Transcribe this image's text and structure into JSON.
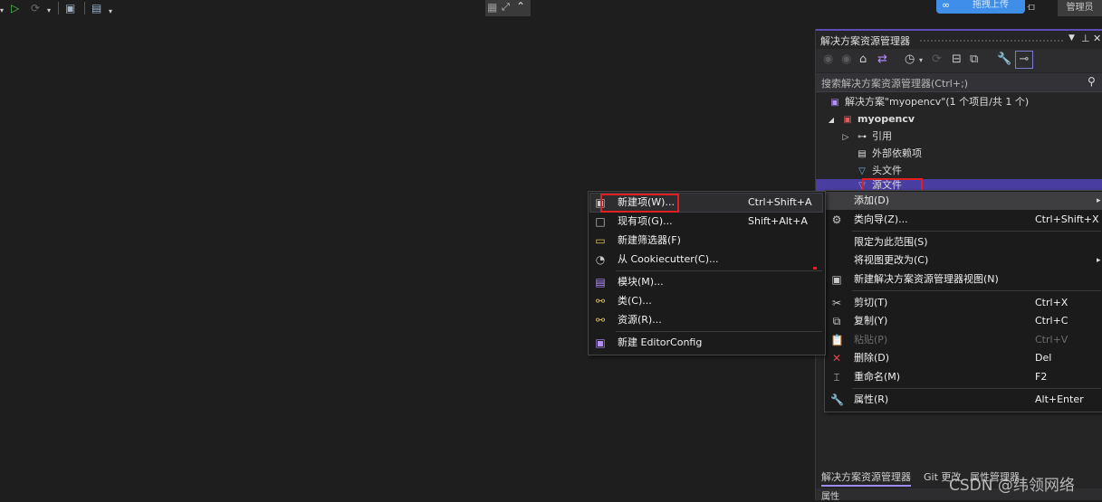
{
  "toolbar": {
    "icons": [
      "dropdown-arrow-icon",
      "run-icon",
      "debug-target-icon",
      "dropdown-arrow-icon",
      "folder-icon",
      "window-layout-icon",
      "dropdown-arrow-icon"
    ],
    "center_icons": [
      "grid-icon",
      "expand-icon",
      "chevron-up-icon"
    ],
    "upload_label": "拖拽上传",
    "admin_label": "管理员"
  },
  "solution_explorer": {
    "title": "解决方案资源管理器",
    "pin_glyphs": [
      "▾",
      "ⲡ",
      "✕"
    ],
    "search_placeholder": "搜索解决方案资源管理器(Ctrl+;)",
    "tree": [
      {
        "label": "解决方案\"myopencv\"(1 个项目/共 1 个)",
        "icon": "solution-icon"
      },
      {
        "label": "myopencv",
        "icon": "project-icon"
      },
      {
        "label": "引用",
        "icon": "references-icon"
      },
      {
        "label": "外部依赖项",
        "icon": "external-deps-icon"
      },
      {
        "label": "头文件",
        "icon": "filter-folder-icon"
      },
      {
        "label": "源文件",
        "icon": "filter-folder-icon"
      }
    ],
    "bottom_tabs": [
      "解决方案资源管理器",
      "Git 更改",
      "属性管理器"
    ],
    "properties_label": "属性"
  },
  "context_menu_main": {
    "items": [
      {
        "label": "添加(D)",
        "shortcut": "",
        "submenu": true,
        "icon": ""
      },
      {
        "label": "类向导(Z)...",
        "shortcut": "Ctrl+Shift+X",
        "icon": "class-wizard-icon"
      },
      {
        "label": "限定为此范围(S)",
        "shortcut": "",
        "icon": ""
      },
      {
        "label": "将视图更改为(C)",
        "shortcut": "",
        "submenu": true,
        "icon": ""
      },
      {
        "label": "新建解决方案资源管理器视图(N)",
        "shortcut": "",
        "icon": "new-view-icon"
      },
      {
        "label": "剪切(T)",
        "shortcut": "Ctrl+X",
        "icon": "cut-icon"
      },
      {
        "label": "复制(Y)",
        "shortcut": "Ctrl+C",
        "icon": "copy-icon"
      },
      {
        "label": "粘贴(P)",
        "shortcut": "Ctrl+V",
        "icon": "paste-icon",
        "disabled": true
      },
      {
        "label": "删除(D)",
        "shortcut": "Del",
        "icon": "delete-icon"
      },
      {
        "label": "重命名(M)",
        "shortcut": "F2",
        "icon": "rename-icon"
      },
      {
        "label": "属性(R)",
        "shortcut": "Alt+Enter",
        "icon": "properties-wrench-icon"
      }
    ]
  },
  "context_menu_add": {
    "items": [
      {
        "label": "新建项(W)...",
        "shortcut": "Ctrl+Shift+A",
        "icon": "new-item-icon"
      },
      {
        "label": "现有项(G)...",
        "shortcut": "Shift+Alt+A",
        "icon": "existing-item-icon"
      },
      {
        "label": "新建筛选器(F)",
        "shortcut": "",
        "icon": "new-filter-icon"
      },
      {
        "label": "从 Cookiecutter(C)...",
        "shortcut": "",
        "icon": "cookiecutter-icon"
      },
      {
        "label": "模块(M)...",
        "shortcut": "",
        "icon": "module-icon"
      },
      {
        "label": "类(C)...",
        "shortcut": "",
        "icon": "class-icon"
      },
      {
        "label": "资源(R)...",
        "shortcut": "",
        "icon": "resource-icon"
      },
      {
        "label": "新建 EditorConfig",
        "shortcut": "",
        "icon": "editorconfig-icon"
      }
    ]
  },
  "watermark": "CSDN @纬领网络"
}
